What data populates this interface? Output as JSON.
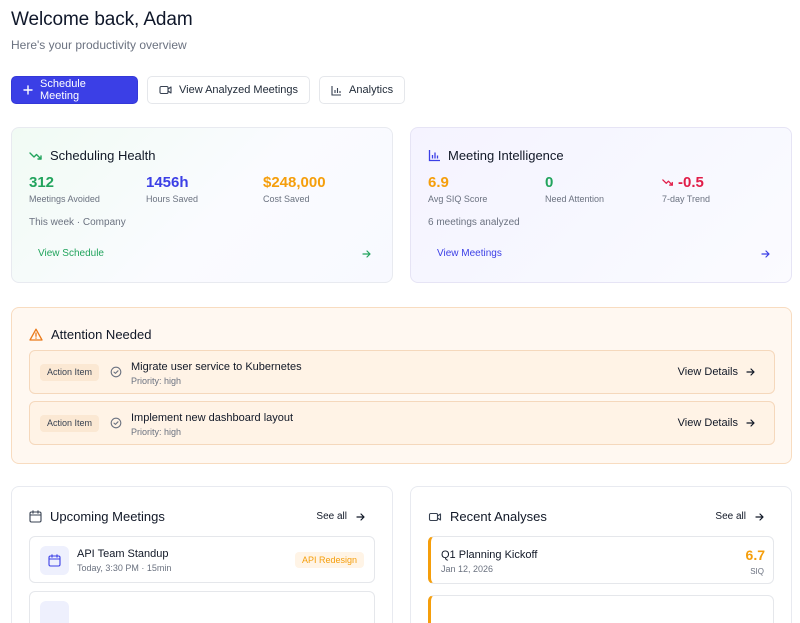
{
  "header": {
    "title": "Welcome back, Adam",
    "subtitle": "Here's your productivity overview"
  },
  "actions": {
    "schedule": "Schedule Meeting",
    "analyzed": "View Analyzed Meetings",
    "analytics": "Analytics"
  },
  "health": {
    "title": "Scheduling Health",
    "stats": [
      {
        "value": "312",
        "label": "Meetings Avoided",
        "color": "#22a45d"
      },
      {
        "value": "1456h",
        "label": "Hours Saved",
        "color": "#3b3fe6"
      },
      {
        "value": "$248,000",
        "label": "Cost Saved",
        "color": "#f59e0b"
      }
    ],
    "meta": "This week · Company",
    "link": "View Schedule",
    "link_color": "#22a45d"
  },
  "intelligence": {
    "title": "Meeting Intelligence",
    "stats": [
      {
        "value": "6.9",
        "label": "Avg SIQ Score",
        "color": "#f59e0b"
      },
      {
        "value": "0",
        "label": "Need Attention",
        "color": "#22a45d"
      },
      {
        "value": "-0.5",
        "label": "7-day Trend",
        "color": "#e11d48"
      }
    ],
    "meta": "6 meetings analyzed",
    "link": "View Meetings",
    "link_color": "#3b3fe6"
  },
  "attention": {
    "title": "Attention Needed",
    "items": [
      {
        "tag": "Action Item",
        "title": "Migrate user service to Kubernetes",
        "priority": "Priority: high",
        "action": "View Details"
      },
      {
        "tag": "Action Item",
        "title": "Implement new dashboard layout",
        "priority": "Priority: high",
        "action": "View Details"
      }
    ]
  },
  "upcoming": {
    "title": "Upcoming Meetings",
    "see_all": "See all",
    "items": [
      {
        "title": "API Team Standup",
        "time": "Today, 3:30 PM · 15min",
        "badge": "API Redesign"
      }
    ]
  },
  "recent": {
    "title": "Recent Analyses",
    "see_all": "See all",
    "items": [
      {
        "title": "Q1 Planning Kickoff",
        "date": "Jan 12, 2026",
        "score": "6.7",
        "score_label": "SIQ"
      }
    ]
  },
  "icons": {
    "schedule": "plus-icon",
    "analyzed": "video-icon",
    "analytics": "bar-chart-icon",
    "health": "trending-down-icon",
    "intelligence": "bar-chart-icon",
    "attention": "warning-triangle-icon",
    "upcoming": "calendar-icon",
    "recent": "video-icon"
  }
}
